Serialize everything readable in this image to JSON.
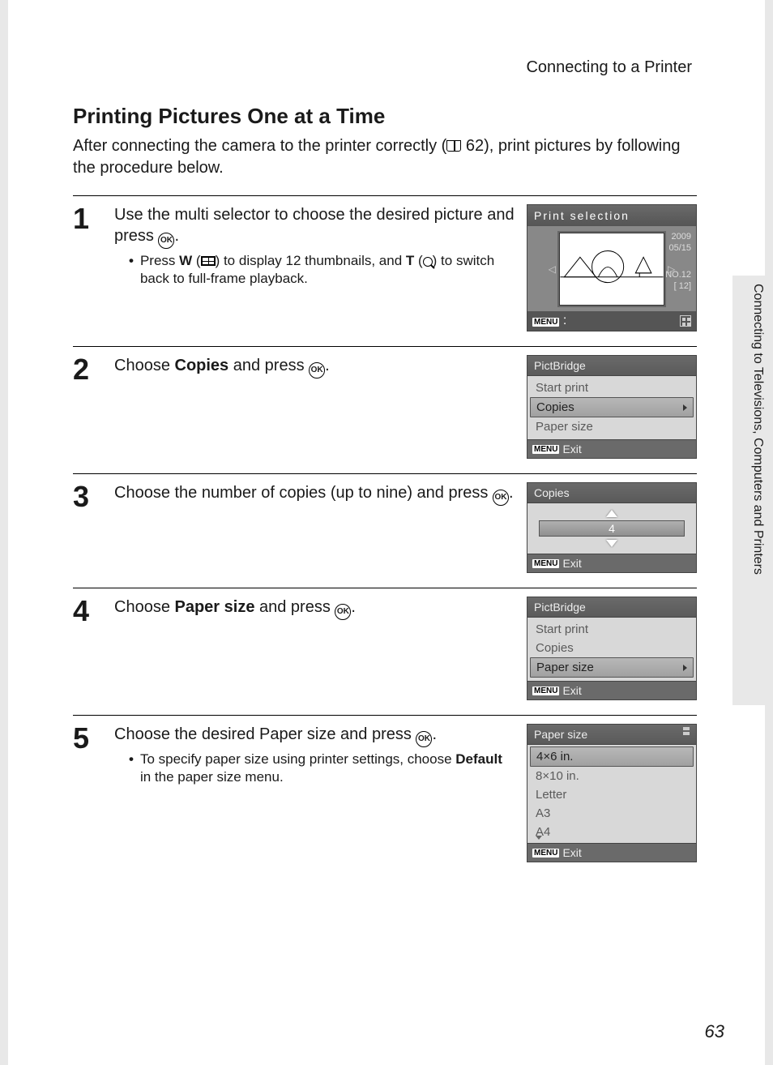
{
  "header": {
    "section": "Connecting to a Printer"
  },
  "title": "Printing Pictures One at a Time",
  "intro_a": "After connecting the camera to the printer correctly (",
  "intro_ref": "62",
  "intro_b": "), print pictures by following the procedure below.",
  "ok_label": "OK",
  "steps": {
    "s1": {
      "num": "1",
      "text_a": "Use the multi selector to choose the desired picture and press ",
      "bullet_a": "Press ",
      "bullet_w": "W",
      "bullet_b": " (",
      "bullet_c": ") to display 12 thumbnails, and ",
      "bullet_t": "T",
      "bullet_d": " (",
      "bullet_e": ") to switch back to full-frame playback."
    },
    "s2": {
      "num": "2",
      "text_a": "Choose ",
      "text_bold": "Copies",
      "text_b": " and press "
    },
    "s3": {
      "num": "3",
      "text": "Choose the number of copies (up to nine) and press "
    },
    "s4": {
      "num": "4",
      "text_a": "Choose ",
      "text_bold": "Paper size",
      "text_b": " and press "
    },
    "s5": {
      "num": "5",
      "text": "Choose the desired Paper size and press ",
      "bullet_a": "To specify paper size using printer settings, choose ",
      "bullet_bold": "Default",
      "bullet_b": " in the paper size menu."
    }
  },
  "lcd_ps": {
    "title": "Print selection",
    "date1": "2009",
    "date2": "05/15",
    "no": "NO.12",
    "count": "[  12]",
    "menu": "MENU"
  },
  "lcd_pb": {
    "title": "PictBridge",
    "items": [
      "Start print",
      "Copies",
      "Paper size"
    ],
    "exit": "Exit",
    "menu": "MENU"
  },
  "lcd_copies": {
    "title": "Copies",
    "value": "4",
    "exit": "Exit",
    "menu": "MENU"
  },
  "lcd_pb2": {
    "title": "PictBridge",
    "items": [
      "Start print",
      "Copies",
      "Paper size"
    ],
    "exit": "Exit",
    "menu": "MENU"
  },
  "lcd_size": {
    "title": "Paper size",
    "items": [
      "4×6 in.",
      "8×10 in.",
      "Letter",
      "A3",
      "A4"
    ],
    "exit": "Exit",
    "menu": "MENU"
  },
  "side_tab": "Connecting to Televisions, Computers and Printers",
  "page_num": "63"
}
